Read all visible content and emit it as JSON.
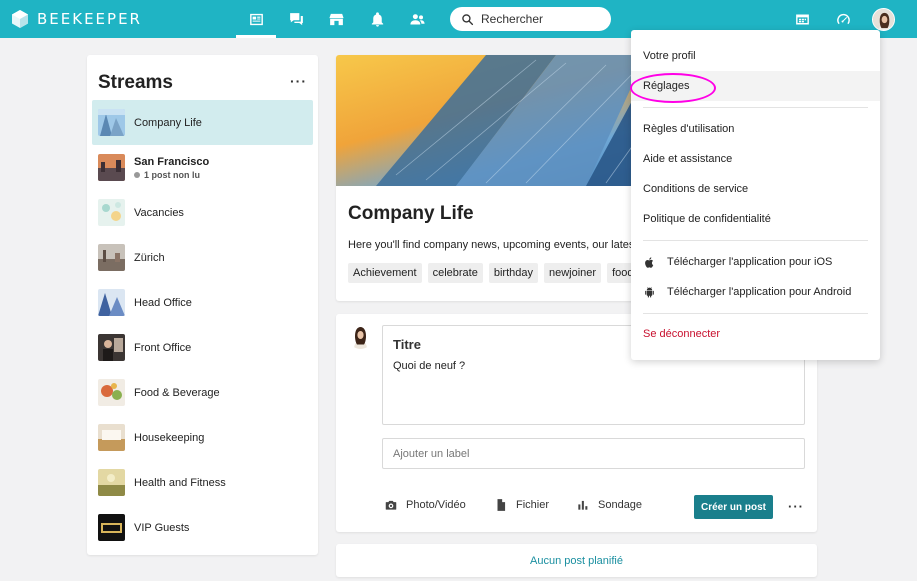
{
  "app": {
    "brand_name": "BEEKEEPER",
    "search_placeholder": "Rechercher"
  },
  "colors": {
    "topbar": "#1fb4c4",
    "primary_button": "#1a7f8c",
    "link": "#1a8fa0",
    "logout": "#c8102e",
    "selected_stream": "#d2ecee",
    "annotation_ring": "#ff00e6"
  },
  "nav": {
    "icons": [
      "streams-icon",
      "chat-icon",
      "store-icon",
      "bell-icon",
      "people-icon"
    ],
    "active": "streams-icon",
    "right_icons": [
      "shift-icon",
      "speedometer-icon",
      "avatar"
    ]
  },
  "streams": {
    "title": "Streams",
    "more_label": "···",
    "items": [
      {
        "name": "Company Life",
        "sub": "",
        "selected": true
      },
      {
        "name": "San Francisco",
        "sub": "1 post non lu",
        "bold": true
      },
      {
        "name": "Vacancies",
        "sub": ""
      },
      {
        "name": "Zürich",
        "sub": ""
      },
      {
        "name": "Head Office",
        "sub": ""
      },
      {
        "name": "Front Office",
        "sub": ""
      },
      {
        "name": "Food & Beverage",
        "sub": ""
      },
      {
        "name": "Housekeeping",
        "sub": ""
      },
      {
        "name": "Health and Fitness",
        "sub": ""
      },
      {
        "name": "VIP Guests",
        "sub": ""
      }
    ]
  },
  "hero": {
    "title": "Company Life",
    "description": "Here you'll find company news, upcoming events, our latest v",
    "tags": [
      "Achievement",
      "celebrate",
      "birthday",
      "newjoiner",
      "food"
    ]
  },
  "composer": {
    "title_placeholder": "Titre",
    "text_placeholder": "Quoi de neuf ?",
    "label_placeholder": "Ajouter un label",
    "actions": {
      "photo": "Photo/Vidéo",
      "file": "Fichier",
      "poll": "Sondage"
    },
    "post_button": "Créer un post",
    "more_label": "···"
  },
  "scheduled": {
    "label": "Aucun post planifié"
  },
  "menu": {
    "items": {
      "profile": "Votre profil",
      "settings": "Réglages",
      "usage_rules": "Règles d'utilisation",
      "help": "Aide et assistance",
      "terms": "Conditions de service",
      "privacy": "Politique de confidentialité",
      "ios": "Télécharger l'application pour iOS",
      "android": "Télécharger l'application pour Android",
      "logout": "Se déconnecter"
    }
  }
}
